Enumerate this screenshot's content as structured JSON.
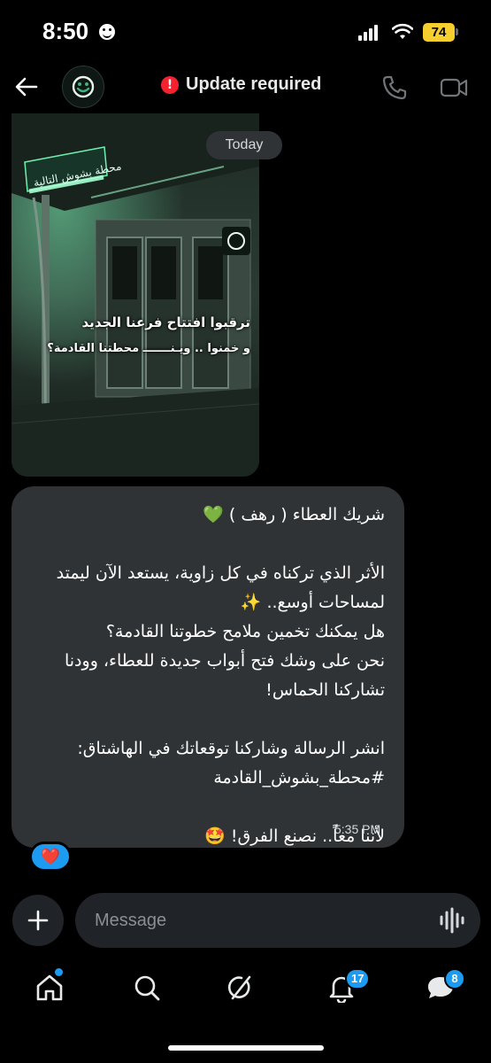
{
  "status": {
    "time": "8:50",
    "battery": "74"
  },
  "header": {
    "title": "Update required"
  },
  "photo": {
    "line1": "ترقبوا افتتاح فرعنا الجديد",
    "line2": "و خمنوا .. ويـنـــــــ محطتنا القادمة؟",
    "sign": "محطة بشوش التالية"
  },
  "chat": {
    "date_label": "Today",
    "message": "شريك العطاء ( رهف ) 💚\n\nالأثر الذي تركناه في كل زاوية، يستعد الآن ليمتد لمساحات أوسع.. ✨\nهل يمكنك تخمين ملامح خطوتنا القادمة؟\nنحن على وشك فتح أبواب جديدة للعطاء، وودنا تشاركنا الحماس!\n\nانشر الرسالة وشاركنا توقعاتك في الهاشتاق:\n#محطة_بشوش_القادمة\n\nلأننا معاً.. نصنع الفرق! 🤩",
    "time": "5:35 PM",
    "reaction": "❤️"
  },
  "composer": {
    "placeholder": "Message"
  },
  "nav": {
    "notifications_badge": "17",
    "messages_badge": "8"
  },
  "icons": {
    "back": "back-arrow-icon",
    "update": "alert-icon",
    "call": "phone-icon",
    "video": "video-camera-icon",
    "add": "plus-icon",
    "voice": "voice-waveform-icon",
    "home": "home-icon",
    "search": "search-icon",
    "grok": "slash-circle-icon",
    "notifications": "bell-icon",
    "messages": "chat-bubble-icon"
  },
  "colors": {
    "accent": "#1d9bf0",
    "bubble": "#2f3336",
    "battery": "#f6cf2e",
    "alert": "#f4212e"
  }
}
